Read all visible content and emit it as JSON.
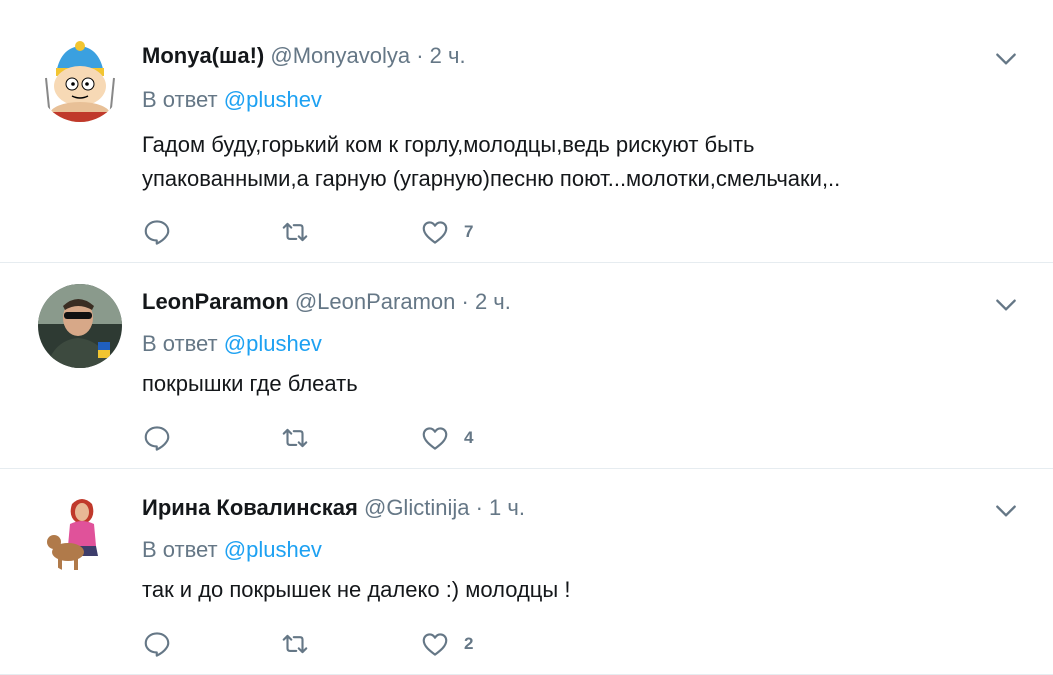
{
  "tweets": [
    {
      "name": "Monya(ша!)",
      "handle": "@Monyavolya",
      "time": "2 ч.",
      "reply_prefix": "В ответ",
      "reply_mention": "@plushev",
      "text_lines": [
        "Гадом буду,горький ком к горлу,молодцы,ведь рискуют быть",
        "упакованными,а гарную (угарную)песню поют...молотки,смельчаки,.."
      ],
      "likes": "7"
    },
    {
      "name": "LeonParamon",
      "handle": "@LeonParamon",
      "time": "2 ч.",
      "reply_prefix": "В ответ",
      "reply_mention": "@plushev",
      "text_lines": [
        "покрышки где блеать"
      ],
      "likes": "4"
    },
    {
      "name": "Ирина Ковалинская",
      "handle": "@Glictinija",
      "time": "1 ч.",
      "reply_prefix": "В ответ",
      "reply_mention": "@plushev",
      "text_lines": [
        "так и до покрышек не далеко :) молодцы !"
      ],
      "likes": "2"
    }
  ],
  "separator": "·",
  "icons": {
    "caret": "chevron-down-icon",
    "reply": "reply-icon",
    "retweet": "retweet-icon",
    "like": "heart-icon"
  },
  "colors": {
    "name": "#14171a",
    "secondary": "#657786",
    "mention": "#1da1f2",
    "divider": "#e6ecf0"
  }
}
